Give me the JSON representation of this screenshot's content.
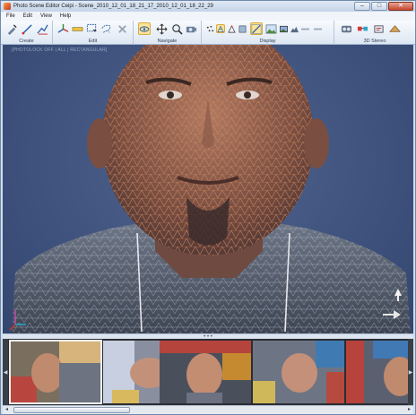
{
  "window": {
    "title": "Photo Scene Editor Ceipi - Scene_2010_12_01_18_21_17_2010_12_01_18_22_29",
    "controls": [
      "–",
      "□",
      "✕"
    ]
  },
  "menu": [
    "File",
    "Edit",
    "View",
    "Help"
  ],
  "ribbon": {
    "groups": [
      {
        "label": "Create"
      },
      {
        "label": "Edit"
      },
      {
        "label": "Navigate"
      },
      {
        "label": "Display"
      },
      {
        "label": "3D Stereo"
      }
    ]
  },
  "viewport": {
    "status": "[PHOTOLOCK OFF | ALL | RECTANGULAR]",
    "background_color": "#3b4f7a",
    "mesh_color": "#c87a4f"
  },
  "filmstrip": {
    "thumbnails": [
      {
        "name": "photo-1",
        "selected": true
      },
      {
        "name": "photo-2",
        "selected": false
      },
      {
        "name": "photo-3",
        "selected": false
      },
      {
        "name": "photo-4",
        "selected": false
      },
      {
        "name": "photo-5",
        "selected": false
      }
    ]
  }
}
